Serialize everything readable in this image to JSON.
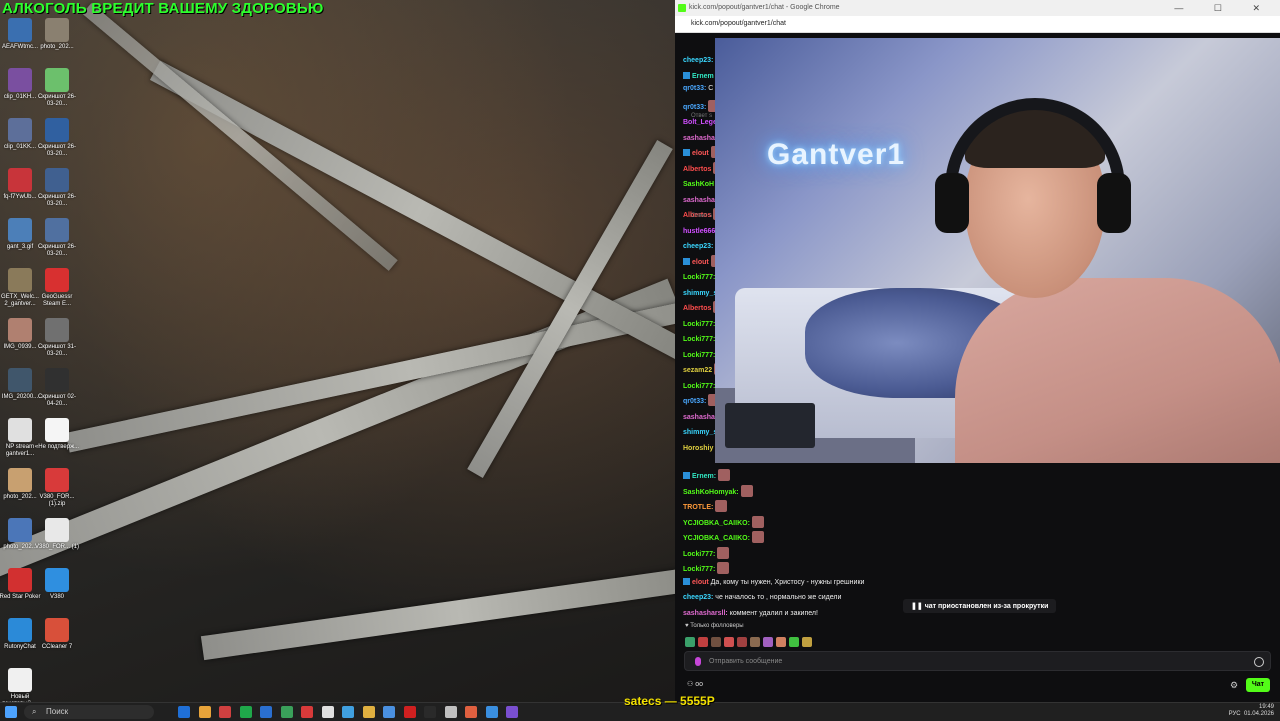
{
  "desktop": {
    "headline": "АЛКОГОЛЬ ВРЕДИТ ВАШЕМУ ЗДОРОВЬЮ",
    "icons_col1": [
      {
        "label": "AEAFWtmc...",
        "color": "#3a6fb0"
      },
      {
        "label": "clip_01KH...",
        "color": "#7a4fa0"
      },
      {
        "label": "clip_01KK...",
        "color": "#5d6f9a"
      },
      {
        "label": "fq-f7YwUb...",
        "color": "#c8343a"
      },
      {
        "label": "gant_3.gif",
        "color": "#4c7fb8"
      },
      {
        "label": "GETX_Welc... 2_gantver...",
        "color": "#8a7a5a"
      },
      {
        "label": "IMG_0939...",
        "color": "#b08070"
      },
      {
        "label": "IMG_20200...",
        "color": "#40566b"
      },
      {
        "label": "NP stream gantver1...",
        "color": "#e0e0e0"
      },
      {
        "label": "photo_202...",
        "color": "#c8a070"
      },
      {
        "label": "photo_202...",
        "color": "#4b76b8"
      },
      {
        "label": "Red Star Poker",
        "color": "#d23030"
      },
      {
        "label": "RutonyChat",
        "color": "#2b8ad8"
      },
      {
        "label": "Новый текстовый ...",
        "color": "#f0f0f0"
      }
    ],
    "icons_col2": [
      {
        "label": "photo_202...",
        "color": "#8a8070"
      },
      {
        "label": "Скриншот 26-03-20...",
        "color": "#6cc06c"
      },
      {
        "label": "Скриншот 26-03-20...",
        "color": "#3060a0"
      },
      {
        "label": "Скриншот 26-03-20...",
        "color": "#406090"
      },
      {
        "label": "Скриншот 26-03-20...",
        "color": "#5070a0"
      },
      {
        "label": "GeoGuessr Steam E...",
        "color": "#d83030"
      },
      {
        "label": "Скриншот 31-03-20...",
        "color": "#707070"
      },
      {
        "label": "Скриншот 02-04-20...",
        "color": "#303030"
      },
      {
        "label": "«Не подтверж...",
        "color": "#f5f5f5"
      },
      {
        "label": "V380_FOR... (1).zip",
        "color": "#d83a3a"
      },
      {
        "label": "V380_FOR... (1)",
        "color": "#e8e8e8"
      },
      {
        "label": "V380",
        "color": "#2f8fe0"
      },
      {
        "label": "CCleaner 7",
        "color": "#d8503a"
      }
    ]
  },
  "taskbar": {
    "search_label": "Поиск",
    "overlay_nick": "satecs — 5555P",
    "lang": "РУС",
    "time": "19:49",
    "date": "01.04.2026",
    "app_colors": [
      "#1f6fd6",
      "#e8a43a",
      "#d04040",
      "#1fa84a",
      "#2a6fd0",
      "#3aa05a",
      "#d83a3a",
      "#e0e0e0",
      "#40a0e0",
      "#e0b040",
      "#4a90e0",
      "#d02020",
      "#2a2a2a",
      "#c0c0c0",
      "#e06040",
      "#3a8fe0",
      "#7a4fd0"
    ]
  },
  "browser": {
    "title": "kick.com/popout/gantver1/chat - Google Chrome",
    "url": "kick.com/popout/gantver1/chat",
    "win_buttons": "— ☐ ✕"
  },
  "video": {
    "neon_text": "Gantver1"
  },
  "chat": {
    "top_messages": [
      {
        "user": "cheep23:",
        "color": "#3ad7ff",
        "text": "",
        "badge": false
      },
      {
        "user": "Ernem",
        "color": "#31e7c2",
        "text": "",
        "badge": true
      },
      {
        "user": "qr0t33:",
        "color": "#4aa8ff",
        "text": "C",
        "badge": false
      },
      {
        "user": "qr0t33:",
        "color": "#4aa8ff",
        "text": "",
        "badge": false
      },
      {
        "user": "Bolt_Lege",
        "color": "#d04fff",
        "text": "",
        "badge": false
      },
      {
        "user": "sashasha",
        "color": "#e06bd0",
        "text": "",
        "badge": false
      },
      {
        "user": "elout",
        "color": "#ff5757",
        "text": "",
        "badge": true
      },
      {
        "user": "Albertos",
        "color": "#ff4d4d",
        "text": "",
        "badge": false
      },
      {
        "user": "SashKoH",
        "color": "#53fc18",
        "text": "",
        "badge": false
      },
      {
        "user": "sashasha",
        "color": "#e06bd0",
        "text": "",
        "badge": false
      },
      {
        "user": "Albertos",
        "color": "#ff4d4d",
        "text": "",
        "badge": false
      },
      {
        "user": "hustle666",
        "color": "#d04fff",
        "text": "",
        "badge": false
      },
      {
        "user": "cheep23:",
        "color": "#3ad7ff",
        "text": "",
        "badge": false
      },
      {
        "user": "elout",
        "color": "#ff5757",
        "text": "",
        "badge": true
      },
      {
        "user": "Locki777:",
        "color": "#53fc18",
        "text": "",
        "badge": false
      },
      {
        "user": "shimmy_s",
        "color": "#3ad7ff",
        "text": "",
        "badge": false
      },
      {
        "user": "Albertos",
        "color": "#ff4d4d",
        "text": "",
        "badge": false
      },
      {
        "user": "Locki777:",
        "color": "#53fc18",
        "text": "",
        "badge": false
      },
      {
        "user": "Locki777:",
        "color": "#53fc18",
        "text": "",
        "badge": false
      },
      {
        "user": "Locki777:",
        "color": "#53fc18",
        "text": "",
        "badge": false
      },
      {
        "user": "sezam22",
        "color": "#e0d040",
        "text": "",
        "badge": false
      },
      {
        "user": "Locki777:",
        "color": "#53fc18",
        "text": "",
        "badge": false
      },
      {
        "user": "qr0t33:",
        "color": "#4aa8ff",
        "text": "",
        "badge": false
      },
      {
        "user": "sashasha",
        "color": "#e06bd0",
        "text": "",
        "badge": false
      },
      {
        "user": "shimmy_s",
        "color": "#3ad7ff",
        "text": "",
        "badge": false
      },
      {
        "user": "Horoshiy",
        "color": "#e0d040",
        "text": "",
        "badge": false
      }
    ],
    "bottom_messages": [
      {
        "user": "Ernem:",
        "color": "#31e7c2",
        "text": "",
        "badge": true
      },
      {
        "user": "SashKoHomyak:",
        "color": "#53fc18",
        "text": "",
        "badge": false
      },
      {
        "user": "TROTLE:",
        "color": "#ff9a3a",
        "text": "",
        "badge": false
      },
      {
        "user": "YCJIOBKA_CAIIKO:",
        "color": "#53fc18",
        "text": "",
        "badge": false
      },
      {
        "user": "YCJIOBKA_CAIIKO:",
        "color": "#53fc18",
        "text": "",
        "badge": false
      },
      {
        "user": "Locki777:",
        "color": "#53fc18",
        "text": "",
        "badge": false
      },
      {
        "user": "Locki777:",
        "color": "#53fc18",
        "text": "",
        "badge": false
      },
      {
        "user": "elout",
        "color": "#ff5757",
        "text": "Да, кому ты нужен, Христосу - нужны грешники",
        "badge": true
      },
      {
        "user": "cheep23:",
        "color": "#3ad7ff",
        "text": "че началось то , нормально же сидели",
        "badge": false
      },
      {
        "user": "sashasharsll:",
        "color": "#e06bd0",
        "text": "коммент удалил и закипел!",
        "badge": false
      }
    ],
    "reply_label": "Ответ s",
    "pause_notice": "чат приостановлен из-за прокрутки",
    "followers_only": "Только фолловеры",
    "input_placeholder": "Отправить сообщение",
    "points": "oo",
    "send_label": "Чат",
    "emote_colors": [
      "#3aa06a",
      "#c04040",
      "#705040",
      "#d05050",
      "#a04040",
      "#8a6a50",
      "#a060c0",
      "#d08060",
      "#40c040",
      "#c0a040"
    ]
  }
}
